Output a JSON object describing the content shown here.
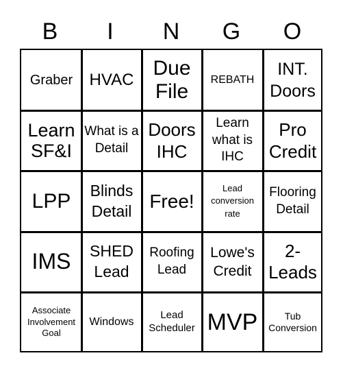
{
  "header": [
    "B",
    "I",
    "N",
    "G",
    "O"
  ],
  "cells": [
    [
      "Graber",
      "HVAC",
      "Due File",
      "REBATH",
      "INT. Doors"
    ],
    [
      "Learn SF&I",
      "What is a Detail",
      "Doors IHC",
      "Learn what is IHC",
      "Pro Credit"
    ],
    [
      "LPP",
      "Blinds Detail",
      "Free!",
      "Lead conversion rate",
      "Flooring Detail"
    ],
    [
      "IMS",
      "SHED Lead",
      "Roofing Lead",
      "Lowe's Credit",
      "2- Leads"
    ],
    [
      "Associate Involvement Goal",
      "Windows",
      "Lead Scheduler",
      "MVP",
      "Tub Conversion"
    ]
  ],
  "free_space": {
    "row": 2,
    "col": 2,
    "label": "Free!"
  }
}
